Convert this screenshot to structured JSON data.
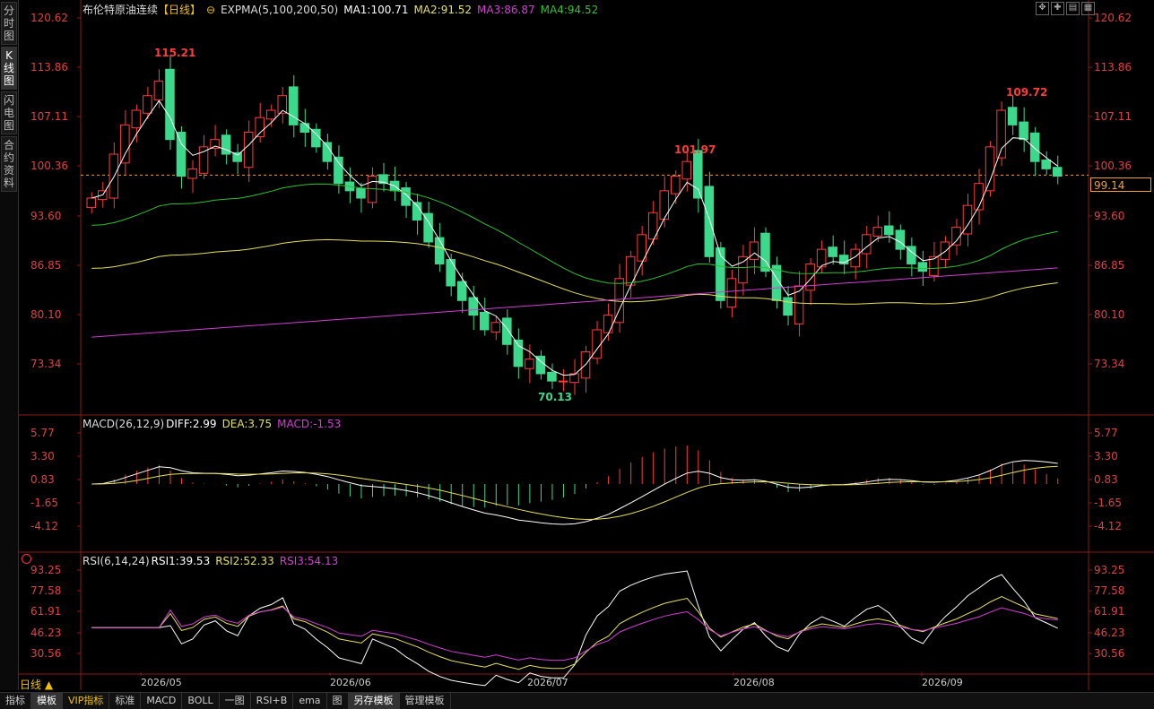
{
  "left_tabs": [
    {
      "label": "分时图"
    },
    {
      "label": "K线图"
    },
    {
      "label": "闪电图"
    },
    {
      "label": "合约资料"
    }
  ],
  "main": {
    "name": "布伦特原油连续",
    "period_tag": "【日线】",
    "indicator": "EXPMA(5,100,200,50)",
    "ma1": "MA1:100.71",
    "ma2": "MA2:91.52",
    "ma3": "MA3:86.87",
    "ma4": "MA4:94.52",
    "y_labels": [
      "120.62",
      "113.86",
      "107.11",
      "100.36",
      "93.60",
      "86.85",
      "80.10",
      "73.34"
    ],
    "current_price": "99.14",
    "high_label": "115.21",
    "high2_label": "109.72",
    "mid_label": "101.97",
    "low_label": "70.13"
  },
  "macd": {
    "title": "MACD(26,12,9)",
    "diff": "DIFF:2.99",
    "dea": "DEA:3.75",
    "macd": "MACD:-1.53",
    "y_labels": [
      "5.77",
      "3.30",
      "0.83",
      "-1.65",
      "-4.12"
    ]
  },
  "rsi": {
    "title": "RSI(6,14,24)",
    "rsi1": "RSI1:39.53",
    "rsi2": "RSI2:52.33",
    "rsi3": "RSI3:54.13",
    "y_labels": [
      "93.25",
      "77.58",
      "61.91",
      "46.23",
      "30.56"
    ]
  },
  "x_labels": [
    "2026/05",
    "2026/06",
    "2026/07",
    "2026/08",
    "2026/09"
  ],
  "period_button": "日线 ▲",
  "bottom_tabs": [
    {
      "label": "指标"
    },
    {
      "label": "模板"
    },
    {
      "label": "VIP指标"
    },
    {
      "label": "标准"
    },
    {
      "label": "MACD"
    },
    {
      "label": "BOLL"
    },
    {
      "label": "一图"
    },
    {
      "label": "RSI+B"
    },
    {
      "label": "ema"
    },
    {
      "label": "图"
    },
    {
      "label": "另存模板"
    },
    {
      "label": "管理模板"
    }
  ],
  "colors": {
    "up": "#ff3b3b",
    "down": "#3cd98c",
    "ma1": "#ffffff",
    "ma2": "#e6e05a",
    "ma3": "#d040d0",
    "ma4": "#30c030",
    "axis_red": "#e04040"
  },
  "chart_data": {
    "type": "candlestick",
    "price_range": [
      70.13,
      115.21
    ],
    "close_approx": [
      96,
      97,
      102,
      106,
      108,
      110,
      112,
      104,
      99,
      100,
      103,
      104,
      102,
      101,
      105,
      107,
      108,
      110,
      106,
      105,
      103,
      101,
      98,
      97,
      96,
      99,
      98,
      97,
      95,
      93,
      90,
      87,
      84,
      82,
      80,
      78,
      79,
      76,
      73,
      74,
      72,
      71,
      71,
      72,
      75,
      78,
      80,
      85,
      88,
      91,
      94,
      97,
      99,
      101,
      96,
      88,
      82,
      85,
      88,
      90,
      86,
      82,
      80,
      84,
      87,
      89,
      88,
      87,
      89,
      91,
      92,
      91,
      89,
      87,
      86,
      88,
      90,
      92,
      95,
      98,
      103,
      108,
      106,
      104,
      101,
      100,
      99
    ],
    "macd": {
      "diff": 2.99,
      "dea": 3.75,
      "macd": -1.53,
      "range": [
        -4.12,
        5.77
      ]
    },
    "rsi": {
      "rsi1": 39.53,
      "rsi2": 52.33,
      "rsi3": 54.13,
      "range": [
        30.56,
        93.25
      ]
    }
  }
}
